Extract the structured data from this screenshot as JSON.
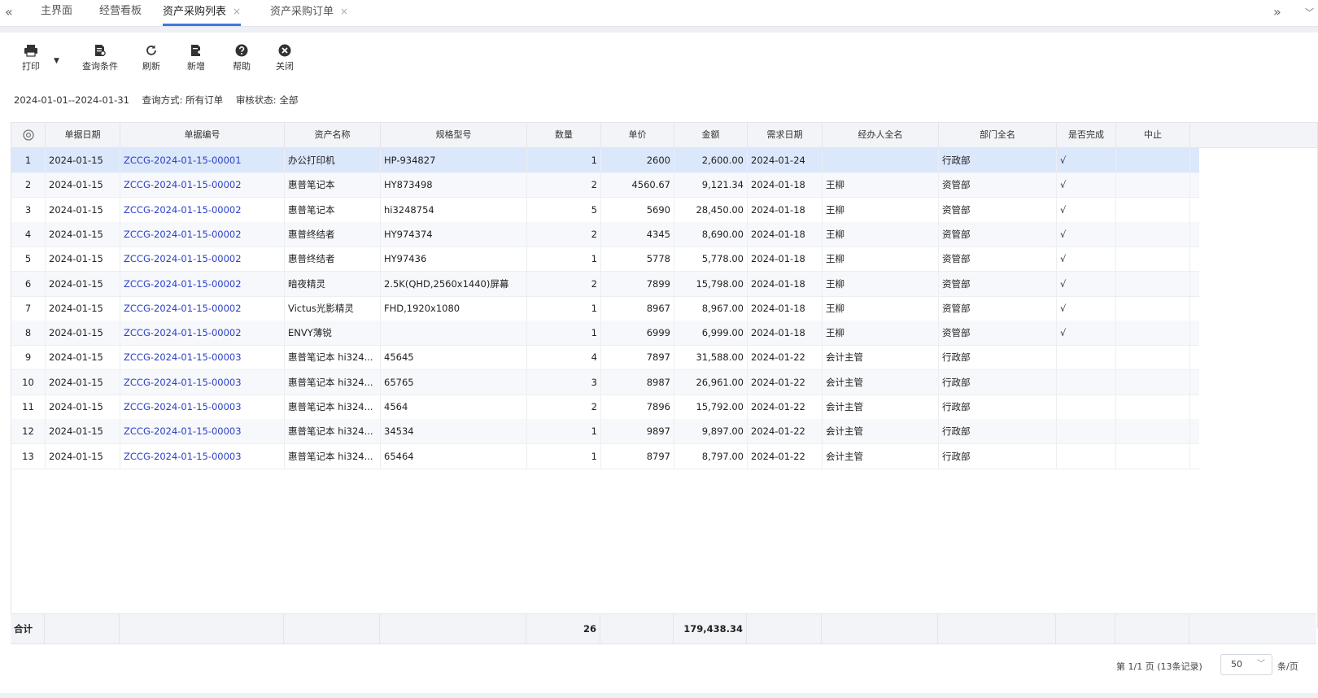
{
  "tabs": {
    "left_arrow": "«",
    "right_arrow": "»",
    "more_arrow": "﹀",
    "items": [
      {
        "label": "主界面",
        "closable": false
      },
      {
        "label": "经营看板",
        "closable": false
      },
      {
        "label": "资产采购列表",
        "closable": true,
        "active": true
      },
      {
        "label": "资产采购订单",
        "closable": true
      }
    ],
    "close_glyph": "×"
  },
  "toolbar": {
    "print": "打印",
    "query": "查询条件",
    "refresh": "刷新",
    "add": "新增",
    "help": "帮助",
    "close": "关闭"
  },
  "filters": {
    "date_range": "2024-01-01--2024-01-31",
    "query_mode": "查询方式: 所有订单",
    "audit_status": "审核状态: 全部"
  },
  "columns": [
    "单据日期",
    "单据编号",
    "资产名称",
    "规格型号",
    "数量",
    "单价",
    "金额",
    "需求日期",
    "经办人全名",
    "部门全名",
    "是否完成",
    "中止"
  ],
  "rows": [
    {
      "n": "1",
      "date": "2024-01-15",
      "code": "ZCCG-2024-01-15-00001",
      "name": "办公打印机",
      "spec": "HP-934827",
      "qty": "1",
      "price": "2600",
      "amount": "2,600.00",
      "need": "2024-01-24",
      "handler": "",
      "dept": "行政部",
      "done": "√",
      "stop": ""
    },
    {
      "n": "2",
      "date": "2024-01-15",
      "code": "ZCCG-2024-01-15-00002",
      "name": "惠普笔记本",
      "spec": "HY873498",
      "qty": "2",
      "price": "4560.67",
      "amount": "9,121.34",
      "need": "2024-01-18",
      "handler": "王柳",
      "dept": "资管部",
      "done": "√",
      "stop": ""
    },
    {
      "n": "3",
      "date": "2024-01-15",
      "code": "ZCCG-2024-01-15-00002",
      "name": "惠普笔记本",
      "spec": "hi3248754",
      "qty": "5",
      "price": "5690",
      "amount": "28,450.00",
      "need": "2024-01-18",
      "handler": "王柳",
      "dept": "资管部",
      "done": "√",
      "stop": ""
    },
    {
      "n": "4",
      "date": "2024-01-15",
      "code": "ZCCG-2024-01-15-00002",
      "name": "惠普终结者",
      "spec": "HY974374",
      "qty": "2",
      "price": "4345",
      "amount": "8,690.00",
      "need": "2024-01-18",
      "handler": "王柳",
      "dept": "资管部",
      "done": "√",
      "stop": ""
    },
    {
      "n": "5",
      "date": "2024-01-15",
      "code": "ZCCG-2024-01-15-00002",
      "name": "惠普终结者",
      "spec": "HY97436",
      "qty": "1",
      "price": "5778",
      "amount": "5,778.00",
      "need": "2024-01-18",
      "handler": "王柳",
      "dept": "资管部",
      "done": "√",
      "stop": ""
    },
    {
      "n": "6",
      "date": "2024-01-15",
      "code": "ZCCG-2024-01-15-00002",
      "name": "暗夜精灵",
      "spec": "2.5K(QHD,2560x1440)屏幕",
      "qty": "2",
      "price": "7899",
      "amount": "15,798.00",
      "need": "2024-01-18",
      "handler": "王柳",
      "dept": "资管部",
      "done": "√",
      "stop": ""
    },
    {
      "n": "7",
      "date": "2024-01-15",
      "code": "ZCCG-2024-01-15-00002",
      "name": "Victus光影精灵",
      "spec": "FHD,1920x1080",
      "qty": "1",
      "price": "8967",
      "amount": "8,967.00",
      "need": "2024-01-18",
      "handler": "王柳",
      "dept": "资管部",
      "done": "√",
      "stop": ""
    },
    {
      "n": "8",
      "date": "2024-01-15",
      "code": "ZCCG-2024-01-15-00002",
      "name": "ENVY薄锐",
      "spec": "",
      "qty": "1",
      "price": "6999",
      "amount": "6,999.00",
      "need": "2024-01-18",
      "handler": "王柳",
      "dept": "资管部",
      "done": "√",
      "stop": ""
    },
    {
      "n": "9",
      "date": "2024-01-15",
      "code": "ZCCG-2024-01-15-00003",
      "name": "惠普笔记本 hi324...",
      "spec": "45645",
      "qty": "4",
      "price": "7897",
      "amount": "31,588.00",
      "need": "2024-01-22",
      "handler": "会计主管",
      "dept": "行政部",
      "done": "",
      "stop": ""
    },
    {
      "n": "10",
      "date": "2024-01-15",
      "code": "ZCCG-2024-01-15-00003",
      "name": "惠普笔记本 hi324...",
      "spec": "65765",
      "qty": "3",
      "price": "8987",
      "amount": "26,961.00",
      "need": "2024-01-22",
      "handler": "会计主管",
      "dept": "行政部",
      "done": "",
      "stop": ""
    },
    {
      "n": "11",
      "date": "2024-01-15",
      "code": "ZCCG-2024-01-15-00003",
      "name": "惠普笔记本 hi324...",
      "spec": "4564",
      "qty": "2",
      "price": "7896",
      "amount": "15,792.00",
      "need": "2024-01-22",
      "handler": "会计主管",
      "dept": "行政部",
      "done": "",
      "stop": ""
    },
    {
      "n": "12",
      "date": "2024-01-15",
      "code": "ZCCG-2024-01-15-00003",
      "name": "惠普笔记本 hi324...",
      "spec": "34534",
      "qty": "1",
      "price": "9897",
      "amount": "9,897.00",
      "need": "2024-01-22",
      "handler": "会计主管",
      "dept": "行政部",
      "done": "",
      "stop": ""
    },
    {
      "n": "13",
      "date": "2024-01-15",
      "code": "ZCCG-2024-01-15-00003",
      "name": "惠普笔记本 hi324...",
      "spec": "65464",
      "qty": "1",
      "price": "8797",
      "amount": "8,797.00",
      "need": "2024-01-22",
      "handler": "会计主管",
      "dept": "行政部",
      "done": "",
      "stop": ""
    }
  ],
  "summary": {
    "label": "合计",
    "qty": "26",
    "amount": "179,438.34"
  },
  "pager": {
    "info": "第 1/1 页 (13条记录)",
    "page_size": "50",
    "unit": "条/页"
  }
}
